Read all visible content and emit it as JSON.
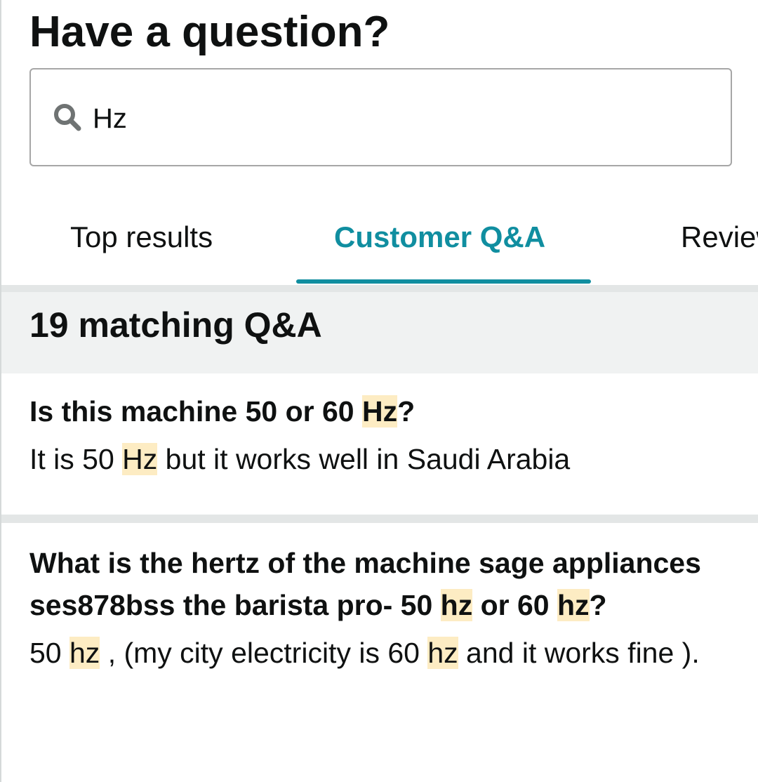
{
  "page": {
    "heading": "Have a question?"
  },
  "search": {
    "value": "Hz",
    "icon": "search-icon"
  },
  "tabs": [
    {
      "label": "Top results",
      "selected": false
    },
    {
      "label": "Customer Q&A",
      "selected": true
    },
    {
      "label": "Reviews",
      "selected": false
    }
  ],
  "results": {
    "count_label": "19 matching Q&A"
  },
  "qa": [
    {
      "question_parts": [
        "Is this machine 50 or 60 ",
        "Hz",
        "?"
      ],
      "answer_parts": [
        "It is 50 ",
        "Hz",
        " but it works well in Saudi Arabia"
      ]
    },
    {
      "question_parts": [
        "What is the hertz of the machine sage appliances ses878bss the barista pro- 50 ",
        "hz",
        " or 60 ",
        "hz",
        "?"
      ],
      "answer_parts": [
        "50 ",
        "hz",
        " , (my city electricity is 60 ",
        "hz",
        " and it works fine )."
      ]
    }
  ],
  "colors": {
    "accent": "#108ea0",
    "highlight": "#fdecc3",
    "text": "#0f1111",
    "divider": "#e3e6e6",
    "band": "#f0f2f2"
  }
}
